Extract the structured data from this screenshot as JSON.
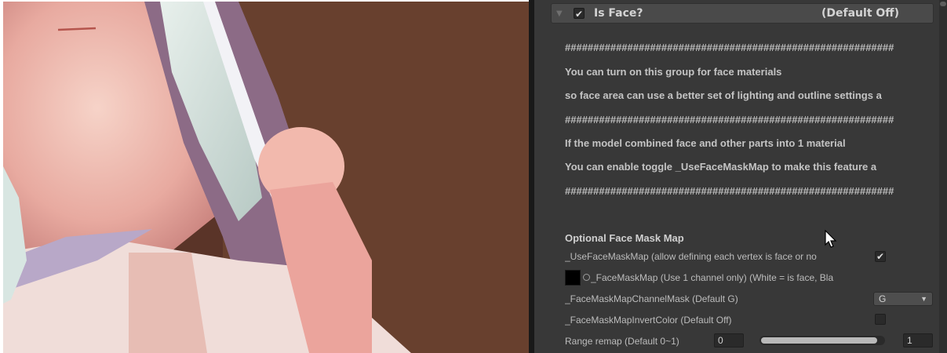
{
  "viewport": {
    "label": "Scene view render"
  },
  "inspector": {
    "group_header": {
      "title": "Is Face?",
      "default_label": "(Default Off)",
      "toggle_checked": "✔",
      "foldout_glyph": "▼"
    },
    "notes": [
      "##########################################################",
      "You can turn on this group for face materials",
      "so face area can use a better set of lighting and outline settings a",
      "##########################################################",
      "If the model combined face and other parts into 1 material",
      "You can enable toggle _UseFaceMaskMap to make this feature a",
      "##########################################################"
    ],
    "section_title": "Optional Face Mask Map",
    "properties": {
      "use_face_mask_map": {
        "label": "_UseFaceMaskMap (allow defining each vertex is face or no",
        "checked": "✔"
      },
      "face_mask_map": {
        "label": "_FaceMaskMap (Use 1 channel only) (White = is face, Bla"
      },
      "channel_mask": {
        "label": "_FaceMaskMapChannelMask (Default G)",
        "value": "G",
        "arrow": "▼"
      },
      "invert_color": {
        "label": "_FaceMaskMapInvertColor (Default Off)"
      },
      "range_remap": {
        "label": "Range remap (Default 0~1)",
        "min": "0",
        "max": "1",
        "fill_fraction": 0.95
      }
    }
  }
}
